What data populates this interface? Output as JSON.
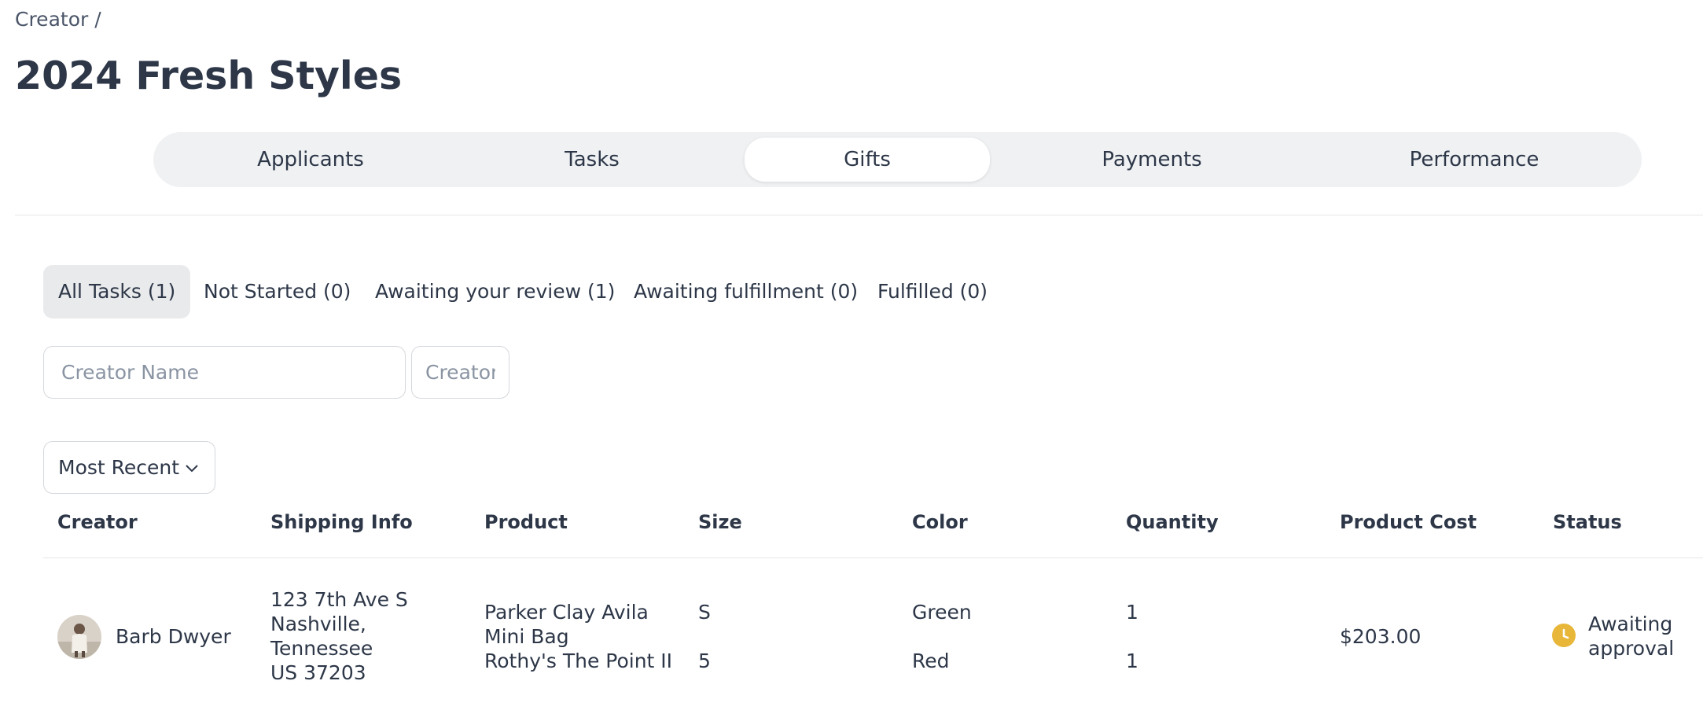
{
  "breadcrumb": {
    "text": "Creator /"
  },
  "page": {
    "title": "2024 Fresh Styles"
  },
  "tabs": [
    "Applicants",
    "Tasks",
    "Gifts",
    "Payments",
    "Performance"
  ],
  "active_tab": "Gifts",
  "filters": [
    "All Tasks (1)",
    "Not Started (0)",
    "Awaiting your review (1)",
    "Awaiting fulfillment (0)",
    "Fulfilled (0)"
  ],
  "active_filter": "All Tasks (1)",
  "search": {
    "name_placeholder": "Creator Name",
    "creator_placeholder": "Creator"
  },
  "sort": {
    "selected": "Most Recent",
    "icon": "chevron-down-icon"
  },
  "table": {
    "headers": [
      "Creator",
      "Shipping Info",
      "Product",
      "Size",
      "Color",
      "Quantity",
      "Product Cost",
      "Status"
    ],
    "rows": [
      {
        "creator": "Barb Dwyer",
        "shipping": [
          "123 7th Ave S",
          "Nashville,",
          "Tennessee",
          "US 37203"
        ],
        "products": [
          "Parker Clay Avila",
          "Mini Bag",
          "Rothy's The Point II"
        ],
        "sizes": [
          "S",
          "5"
        ],
        "colors": [
          "Green",
          "Red"
        ],
        "quantities": [
          "1",
          "1"
        ],
        "cost": "$203.00",
        "status": [
          "Awaiting",
          "approval"
        ],
        "status_icon": "clock-icon",
        "status_color": "#e8b73a"
      }
    ]
  },
  "colors": {
    "text": "#2d3748",
    "tabbar_bg": "#eff1f3",
    "active_filter_bg": "#e9eaec",
    "border": "#d5d8dd"
  }
}
